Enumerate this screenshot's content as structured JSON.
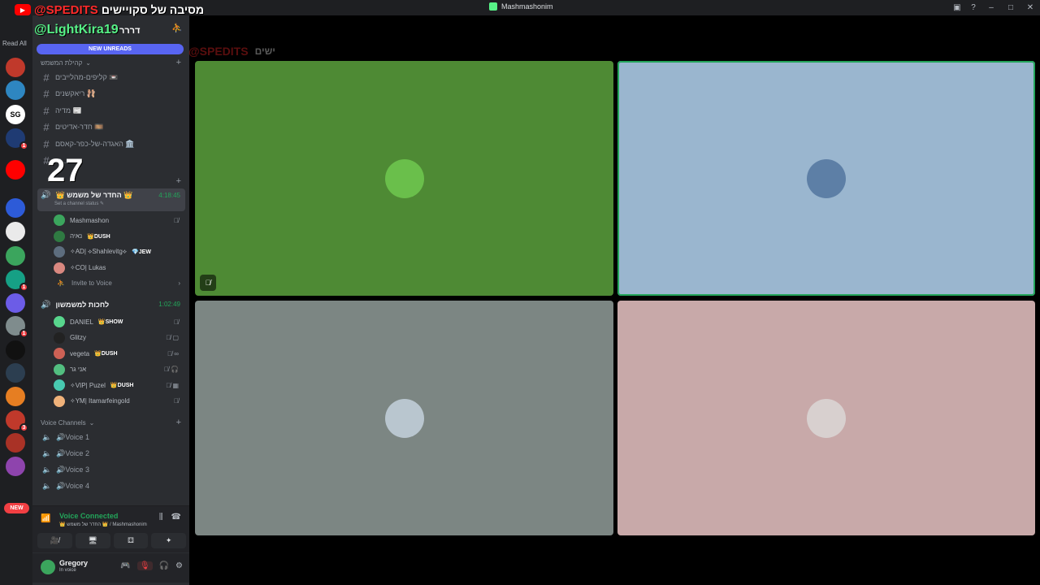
{
  "window": {
    "title": "Mashmashonim",
    "controls": {
      "inbox": "▣",
      "help": "?",
      "minimize": "–",
      "maximize": "□",
      "close": "✕"
    }
  },
  "overlay": {
    "spedits": "@SPEDITS",
    "spedits_tag": "מסיבה של סקויישים",
    "handle": "@LightKira19",
    "handle_tag": "דררר",
    "count": "27",
    "faint_tag": "ישים"
  },
  "guilds": {
    "read_all": "Read All",
    "new_label": "NEW",
    "items": [
      {
        "label": "",
        "color": "#c0392b",
        "badge": ""
      },
      {
        "label": "",
        "color": "#2e86c1",
        "badge": ""
      },
      {
        "label": "SG",
        "color": "#ffffff",
        "badge": ""
      },
      {
        "label": "",
        "color": "#1f3b73",
        "badge": "1"
      },
      {
        "label": "",
        "color": "#ff0000",
        "badge": ""
      },
      {
        "label": "",
        "color": "#2d5bd8",
        "badge": ""
      },
      {
        "label": "",
        "color": "#eaeaea",
        "badge": ""
      },
      {
        "label": "",
        "color": "#3ba55d",
        "badge": ""
      },
      {
        "label": "",
        "color": "#16a085",
        "badge": "1"
      },
      {
        "label": "",
        "color": "#6c5ce7",
        "badge": ""
      },
      {
        "label": "",
        "color": "#7f8c8d",
        "badge": "1"
      },
      {
        "label": "",
        "color": "#111111",
        "badge": ""
      },
      {
        "label": "",
        "color": "#2c3e50",
        "badge": ""
      },
      {
        "label": "",
        "color": "#e67e22",
        "badge": ""
      },
      {
        "label": "",
        "color": "#c0392b",
        "badge": "3"
      },
      {
        "label": "",
        "color": "#a93226",
        "badge": ""
      },
      {
        "label": "",
        "color": "#8e44ad",
        "badge": ""
      }
    ]
  },
  "sidebar": {
    "new_unreads": "NEW UNREADS",
    "categories": {
      "text": "קהילת המשמש",
      "voice": "Voice Channels"
    },
    "text_channels": [
      {
        "label": "קליפים-מהלייבים 📼"
      },
      {
        "label": "ריאקשנים 🩰"
      },
      {
        "label": "מדיה 📰"
      },
      {
        "label": "חדר-אדיטים 🎞️"
      },
      {
        "label": "האגדה-של-כפר-קאסם 🏛️"
      },
      {
        "label": "חו..."
      }
    ],
    "voice_channels": [
      {
        "name": "👑 החדר של משמש 👑",
        "time": "4:18:45",
        "status": "Set a channel status ✎",
        "members": [
          {
            "name": "Mashmashon",
            "role": "",
            "icons": "🎙̸",
            "color": "#3ba55d"
          },
          {
            "name": "נאיה",
            "role": "👑DUSH",
            "icons": "",
            "color": "#2f7a42"
          },
          {
            "name": "✧AD| ⟡Shahlevitg⟡",
            "role": "💎JEW",
            "icons": "",
            "color": "#5d6d7e"
          },
          {
            "name": "✧CO| Lukas",
            "role": "",
            "icons": "",
            "color": "#d98880"
          }
        ],
        "invite": "Invite to Voice"
      },
      {
        "name": "לחכות למשמשון",
        "time": "1:02:49",
        "members": [
          {
            "name": "DANIEL",
            "role": "👑SHOW",
            "icons": "🎙̸",
            "color": "#58d68d"
          },
          {
            "name": "Glitzy",
            "role": "",
            "icons": "🎙̸ ▢",
            "color": "#222222"
          },
          {
            "name": "vegeta",
            "role": "👑DUSH",
            "icons": "🎙̸ ∞",
            "color": "#cd6155"
          },
          {
            "name": "אני גר",
            "role": "",
            "icons": "🎙̸ 🎧",
            "color": "#52be80"
          },
          {
            "name": "✧VIP| Puzel",
            "role": "👑DUSH",
            "icons": "🎙̸ ▦",
            "color": "#48c9b0"
          },
          {
            "name": "✧YM| Itamarfeingold",
            "role": "",
            "icons": "🎙̸",
            "color": "#f0b27a"
          }
        ]
      }
    ],
    "general_voice": [
      {
        "label": "🔊Voice 1"
      },
      {
        "label": "🔊Voice 2"
      },
      {
        "label": "🔊Voice 3"
      },
      {
        "label": "🔊Voice 4"
      }
    ]
  },
  "voice_panel": {
    "status": "Voice Connected",
    "sub": "👑 החדר של משמש 👑 / Mashmashonim",
    "buttons": [
      "🎥̸",
      "🖥",
      "⚃",
      "✦"
    ]
  },
  "user": {
    "name": "Gregory",
    "sub": "In voice"
  },
  "stage": {
    "tiles": [
      {
        "bg": "#4e8a34",
        "avatar_color": "#6abf4b",
        "speaking": false,
        "muted": true
      },
      {
        "bg": "#9ab6cf",
        "avatar_color": "#5d7fa6",
        "speaking": true,
        "muted": false
      },
      {
        "bg": "#7c8683",
        "avatar_color": "#b9c6cf",
        "speaking": false,
        "muted": false
      },
      {
        "bg": "#c8a9a9",
        "avatar_color": "#d8d0cf",
        "speaking": false,
        "muted": false
      }
    ]
  }
}
